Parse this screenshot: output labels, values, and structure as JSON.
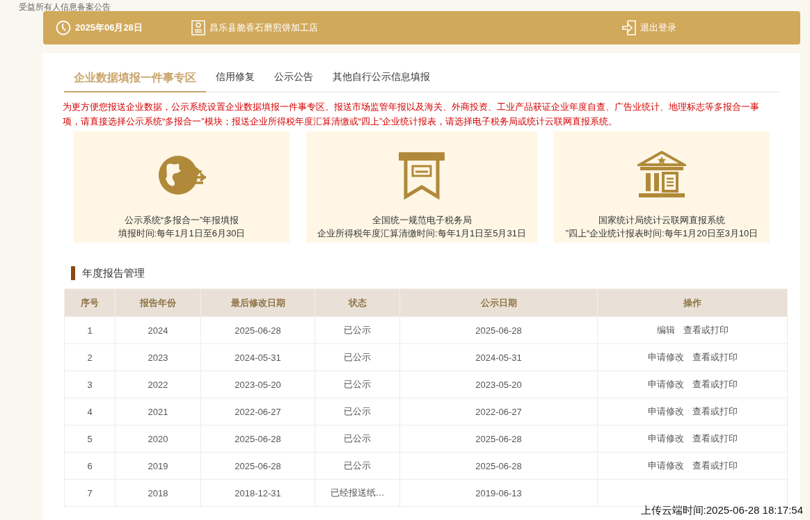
{
  "notice_card": {
    "title": "受益所有人信息备案公告"
  },
  "header": {
    "date": "2025年06月28日",
    "company": "昌乐县脆香石磨煎饼加工店",
    "logout": "退出登录"
  },
  "tabs": [
    {
      "label": "企业数据填报一件事专区",
      "selected": true
    },
    {
      "label": "信用修复",
      "selected": false
    },
    {
      "label": "公示公告",
      "selected": false
    },
    {
      "label": "其他自行公示信息填报",
      "selected": false
    }
  ],
  "notice": "为更方便您报送企业数据，公示系统设置企业数据填报一件事专区。报送市场监管年报以及海关、外商投资、工业产品获证企业年度自查、广告业统计、地理标志等多报合一事项，请直接选择公示系统“多报合一”模块；报送企业所得税年度汇算清缴或“四上”企业统计报表，请选择电子税务局或统计云联网直报系统。",
  "portals": [
    {
      "kind": "globe",
      "title": "公示系统“多报合一”年报填报",
      "period": "填报时间:每年1月1日至6月30日"
    },
    {
      "kind": "tax",
      "title": "全国统一规范电子税务局",
      "period": "企业所得税年度汇算清缴时间:每年1月1日至5月31日"
    },
    {
      "kind": "building",
      "title": "国家统计局统计云联网直报系统",
      "period": "”四上“企业统计报表时间:每年1月20日至3月10日"
    }
  ],
  "section_title": "年度报告管理",
  "table": {
    "columns": [
      "序号",
      "报告年份",
      "最后修改日期",
      "状态",
      "公示日期",
      "操作"
    ],
    "rows": [
      {
        "cells": [
          "1",
          "2024",
          "2025-06-28",
          "已公示",
          "2025-06-28"
        ],
        "actions": [
          "编辑",
          "查看或打印"
        ]
      },
      {
        "cells": [
          "2",
          "2023",
          "2024-05-31",
          "已公示",
          "2024-05-31"
        ],
        "actions": [
          "申请修改",
          "查看或打印"
        ]
      },
      {
        "cells": [
          "3",
          "2022",
          "2023-05-20",
          "已公示",
          "2023-05-20"
        ],
        "actions": [
          "申请修改",
          "查看或打印"
        ]
      },
      {
        "cells": [
          "4",
          "2021",
          "2022-06-27",
          "已公示",
          "2022-06-27"
        ],
        "actions": [
          "申请修改",
          "查看或打印"
        ]
      },
      {
        "cells": [
          "5",
          "2020",
          "2025-06-28",
          "已公示",
          "2025-06-28"
        ],
        "actions": [
          "申请修改",
          "查看或打印"
        ]
      },
      {
        "cells": [
          "6",
          "2019",
          "2025-06-28",
          "已公示",
          "2025-06-28"
        ],
        "actions": [
          "申请修改",
          "查看或打印"
        ]
      },
      {
        "cells": [
          "7",
          "2018",
          "2018-12-31",
          "已经报送纸…",
          "2019-06-13"
        ]
      }
    ]
  },
  "upload_time": "上传云端时间:2025-06-28 18:17:54"
}
